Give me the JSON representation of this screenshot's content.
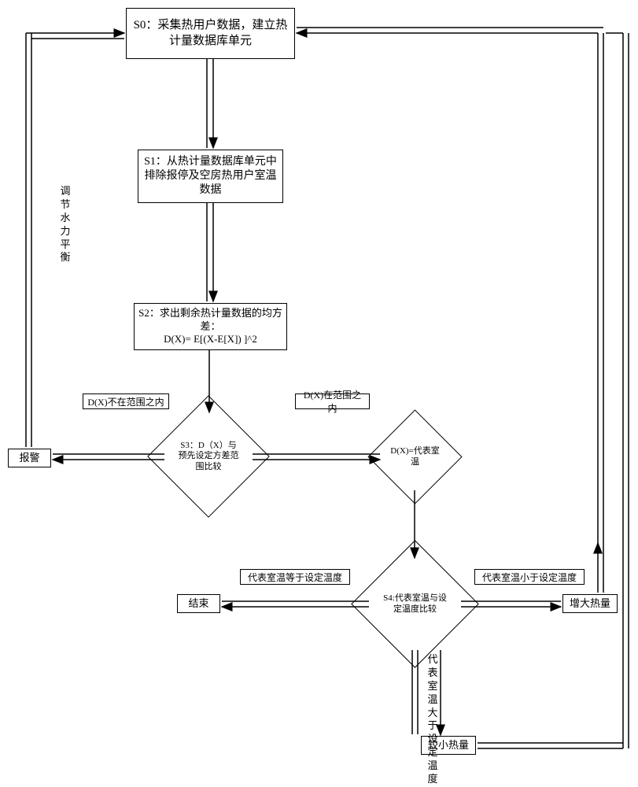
{
  "nodes": {
    "s0": "S0：采集热用户数据，建立热计量数据库单元",
    "s1": "S1：从热计量数据库单元中排除报停及空房热用户室温数据",
    "s2": "S2：求出剩余热计量数据的均方差：\nD(X)= E[(X-E[X]) ]^2",
    "s3": "S3：D（X）与预先设定方差范围比较",
    "s4": "S4:代表室温与设定温度比较",
    "represents": "D(X)=代表室温",
    "alarm": "报警",
    "end": "结束",
    "increase": "增大热量",
    "decrease": "较小热量"
  },
  "edges": {
    "dx_not_in": "D(X)不在范围之内",
    "dx_in": "D(X)在范围之内",
    "rep_eq": "代表室温等于设定温度",
    "rep_lt": "代表室温小于设定温度",
    "rep_gt": "代表室温大于设定温度",
    "adjust": "调节水力平衡"
  }
}
